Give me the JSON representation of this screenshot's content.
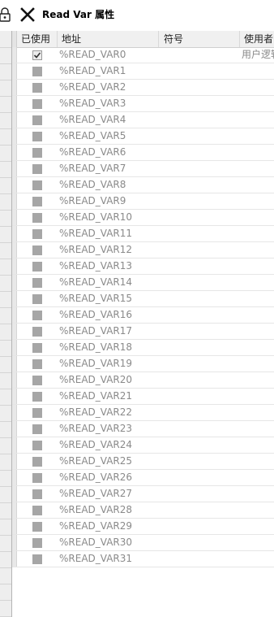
{
  "window": {
    "title": "Read Var 属性"
  },
  "table": {
    "headers": {
      "used": "已使用",
      "address": "地址",
      "symbol": "符号",
      "user": "使用者"
    },
    "rows": [
      {
        "used": true,
        "address": "%READ_VAR0",
        "user": "用户逻辑"
      },
      {
        "used": false,
        "address": "%READ_VAR1",
        "user": ""
      },
      {
        "used": false,
        "address": "%READ_VAR2",
        "user": ""
      },
      {
        "used": false,
        "address": "%READ_VAR3",
        "user": ""
      },
      {
        "used": false,
        "address": "%READ_VAR4",
        "user": ""
      },
      {
        "used": false,
        "address": "%READ_VAR5",
        "user": ""
      },
      {
        "used": false,
        "address": "%READ_VAR6",
        "user": ""
      },
      {
        "used": false,
        "address": "%READ_VAR7",
        "user": ""
      },
      {
        "used": false,
        "address": "%READ_VAR8",
        "user": ""
      },
      {
        "used": false,
        "address": "%READ_VAR9",
        "user": ""
      },
      {
        "used": false,
        "address": "%READ_VAR10",
        "user": ""
      },
      {
        "used": false,
        "address": "%READ_VAR11",
        "user": ""
      },
      {
        "used": false,
        "address": "%READ_VAR12",
        "user": ""
      },
      {
        "used": false,
        "address": "%READ_VAR13",
        "user": ""
      },
      {
        "used": false,
        "address": "%READ_VAR14",
        "user": ""
      },
      {
        "used": false,
        "address": "%READ_VAR15",
        "user": ""
      },
      {
        "used": false,
        "address": "%READ_VAR16",
        "user": ""
      },
      {
        "used": false,
        "address": "%READ_VAR17",
        "user": ""
      },
      {
        "used": false,
        "address": "%READ_VAR18",
        "user": ""
      },
      {
        "used": false,
        "address": "%READ_VAR19",
        "user": ""
      },
      {
        "used": false,
        "address": "%READ_VAR20",
        "user": ""
      },
      {
        "used": false,
        "address": "%READ_VAR21",
        "user": ""
      },
      {
        "used": false,
        "address": "%READ_VAR22",
        "user": ""
      },
      {
        "used": false,
        "address": "%READ_VAR23",
        "user": ""
      },
      {
        "used": false,
        "address": "%READ_VAR24",
        "user": ""
      },
      {
        "used": false,
        "address": "%READ_VAR25",
        "user": ""
      },
      {
        "used": false,
        "address": "%READ_VAR26",
        "user": ""
      },
      {
        "used": false,
        "address": "%READ_VAR27",
        "user": ""
      },
      {
        "used": false,
        "address": "%READ_VAR28",
        "user": ""
      },
      {
        "used": false,
        "address": "%READ_VAR29",
        "user": ""
      },
      {
        "used": false,
        "address": "%READ_VAR30",
        "user": ""
      },
      {
        "used": false,
        "address": "%READ_VAR31",
        "user": ""
      }
    ]
  },
  "icons": {
    "lock": "lock-icon",
    "close": "close-icon",
    "check": "check-icon"
  }
}
